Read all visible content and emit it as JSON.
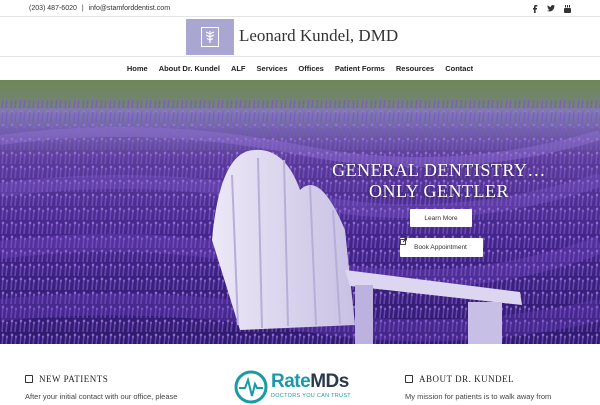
{
  "topbar": {
    "phone": "(203) 487-6020",
    "separator": "|",
    "email": "info@stamforddentist.com",
    "social": [
      "facebook-icon",
      "twitter-icon",
      "youtube-icon"
    ]
  },
  "header": {
    "site_title": "Leonard Kundel, DMD"
  },
  "nav": {
    "items": [
      "Home",
      "About Dr. Kundel",
      "ALF",
      "Services",
      "Offices",
      "Patient Forms",
      "Resources",
      "Contact"
    ]
  },
  "hero": {
    "title_line1": "GENERAL DENTISTRY…",
    "title_line2": "ONLY GENTLER",
    "learn_more": "Learn More",
    "book": "Book Appointment"
  },
  "sections": {
    "new_patients": {
      "title": "NEW PATIENTS",
      "text": "After your initial contact with our office, please"
    },
    "ratemds": {
      "name_rate": "Rate",
      "name_mds": "MDs",
      "tagline": "DOCTORS YOU CAN TRUST"
    },
    "about": {
      "title": "ABOUT DR. KUNDEL",
      "text": "My mission for patients is to walk away from"
    }
  },
  "colors": {
    "logo_bg": "#a9a6d2",
    "ratemds_teal": "#1a9aa8",
    "lavender": "#5a3595"
  }
}
